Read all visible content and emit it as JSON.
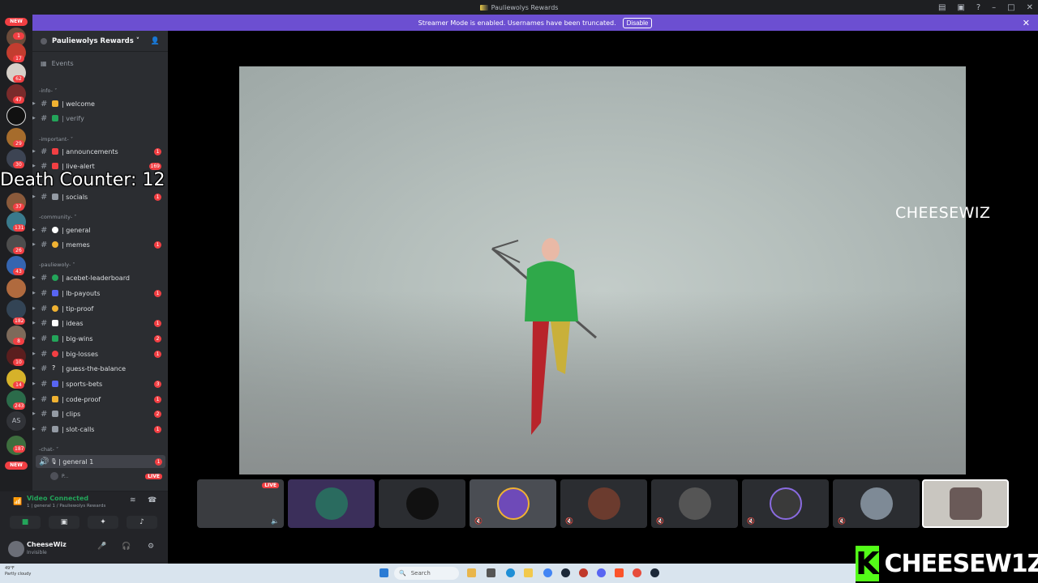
{
  "window": {
    "title": "Pauliewolys Rewards"
  },
  "banner": {
    "text": "Streamer Mode is enabled. Usernames have been truncated.",
    "disable_label": "Disable",
    "close": "✕"
  },
  "rail": {
    "new_top": "NEW",
    "new_bottom": "NEW",
    "as_label": "AS",
    "badges": [
      "1",
      "17",
      "62",
      "47",
      "29",
      "30",
      "37",
      "131",
      "26",
      "43",
      "182",
      "8",
      "10",
      "14",
      "243",
      "187"
    ]
  },
  "server": {
    "name": "Pauliewolys Rewards ˅",
    "events_label": "Events"
  },
  "categories": {
    "info": "-info- ˅",
    "important": "-important- ˅",
    "community": "-community- ˅",
    "pauliewoly": "-pauliewoly- ˅",
    "chat": "-chat- ˅"
  },
  "channels": [
    {
      "name": "| welcome",
      "badge": "",
      "color": "#f0b232"
    },
    {
      "name": "| verify",
      "badge": "",
      "color": "#23a55a"
    },
    {
      "name": "| announcements",
      "badge": "1",
      "color": "#f23f43"
    },
    {
      "name": "| live-alert",
      "badge": "169",
      "color": "#f23f43"
    },
    {
      "name": "| socials",
      "badge": "1",
      "color": "#949ba4"
    },
    {
      "name": "| general",
      "badge": "",
      "color": "#ffffff"
    },
    {
      "name": "| memes",
      "badge": "1",
      "color": "#f0b232"
    },
    {
      "name": "| acebet-leaderboard",
      "badge": "",
      "color": "#23a55a"
    },
    {
      "name": "| lb-payouts",
      "badge": "1",
      "color": "#5865f2"
    },
    {
      "name": "| tip-proof",
      "badge": "",
      "color": "#f0b232"
    },
    {
      "name": "| ideas",
      "badge": "1",
      "color": "#ffffff"
    },
    {
      "name": "| big-wins",
      "badge": "2",
      "color": "#23a55a"
    },
    {
      "name": "| big-losses",
      "badge": "1",
      "color": "#f23f43"
    },
    {
      "name": "| guess-the-balance",
      "badge": "",
      "color": "#ffffff"
    },
    {
      "name": "| sports-bets",
      "badge": "3",
      "color": "#5865f2"
    },
    {
      "name": "| code-proof",
      "badge": "1",
      "color": "#f0b232"
    },
    {
      "name": "| clips",
      "badge": "2",
      "color": "#949ba4"
    },
    {
      "name": "| slot-calls",
      "badge": "1",
      "color": "#949ba4"
    }
  ],
  "voice_channel": {
    "name": "| general 1",
    "badge": "1",
    "user": "P...",
    "live": "LIVE"
  },
  "voice_panel": {
    "status": "Video Connected",
    "sub": "1 | general 1 / Pauliewolys Rewards"
  },
  "user": {
    "name": "CheeseWiz",
    "status": "Invisible"
  },
  "overlay": {
    "death_counter": "Death Counter: 12",
    "streamer_name": "CHEESEWIZ",
    "brand_letter": "K",
    "brand_name": "CHEESEW1Z"
  },
  "tiles": {
    "live_label": "LIVE"
  },
  "taskbar": {
    "weather_temp": "49°F",
    "weather_desc": "Partly cloudy",
    "search_label": "Search"
  }
}
